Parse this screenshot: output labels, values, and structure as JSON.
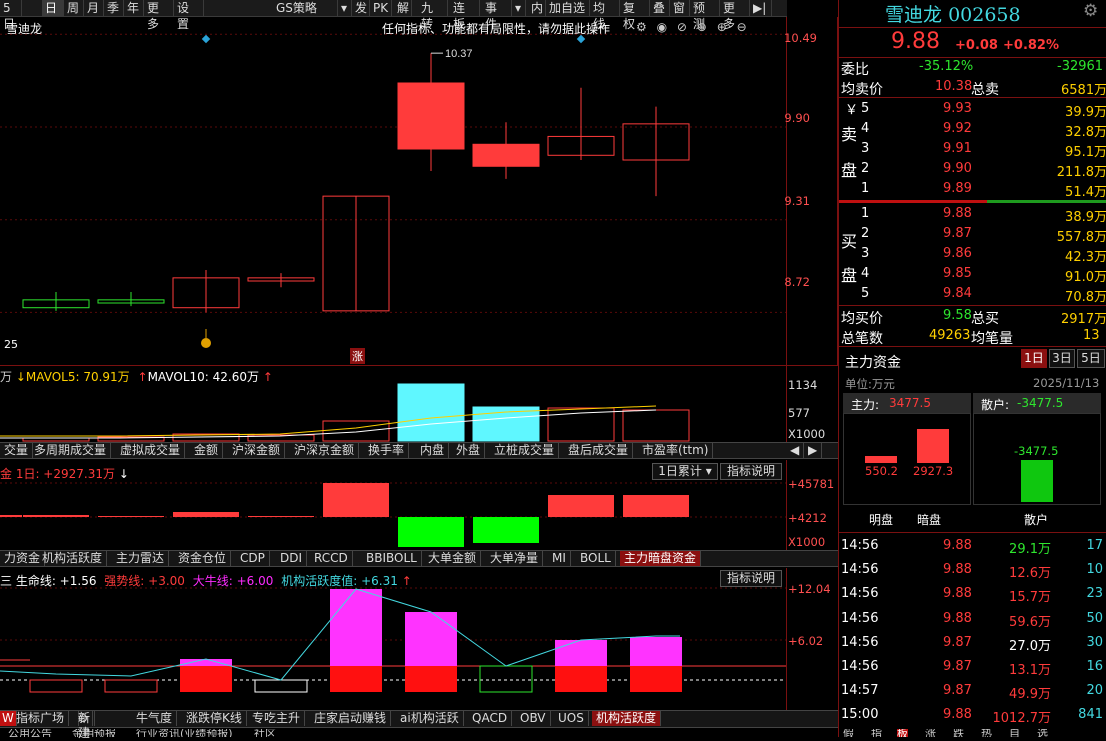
{
  "toolbar": {
    "items": [
      "5日",
      "日",
      "周",
      "月",
      "季",
      "年",
      "更多",
      "设置",
      "GS策略",
      "▾",
      "发",
      "PK",
      "解",
      "九转",
      "连板",
      "事件",
      "▾",
      "内",
      "加自选",
      "均线",
      "复权",
      "叠",
      "窗",
      "预测",
      "更多",
      "▶|"
    ]
  },
  "chart": {
    "title": "雪迪龙",
    "notice": "任何指标、功能都有局限性，请勿据此操作",
    "price_ticks": [
      "10.49",
      "9.90",
      "9.31",
      "8.72"
    ],
    "high_label": "10.37",
    "low_marker": "25",
    "zhang_marker": "涨",
    "candles": [
      {
        "o": 8.75,
        "c": 8.8,
        "h": 8.85,
        "l": 8.73,
        "color": "green"
      },
      {
        "o": 8.78,
        "c": 8.8,
        "h": 8.85,
        "l": 8.76,
        "color": "green"
      },
      {
        "o": 8.75,
        "c": 8.94,
        "h": 8.99,
        "l": 8.72,
        "color": "red"
      },
      {
        "o": 8.92,
        "c": 8.94,
        "h": 8.97,
        "l": 8.88,
        "color": "red"
      },
      {
        "o": 8.73,
        "c": 9.46,
        "h": 9.46,
        "l": 8.73,
        "color": "red_hollow"
      },
      {
        "o": 9.76,
        "c": 10.18,
        "h": 10.37,
        "l": 9.62,
        "color": "red_fill"
      },
      {
        "o": 9.65,
        "c": 9.79,
        "h": 9.93,
        "l": 9.57,
        "color": "red_fill"
      },
      {
        "o": 9.72,
        "c": 9.84,
        "h": 10.15,
        "l": 9.69,
        "color": "red_hollow"
      },
      {
        "o": 9.69,
        "c": 9.92,
        "h": 10.03,
        "l": 9.46,
        "color": "red_hollow"
      }
    ],
    "ylim": [
      8.5,
      10.6
    ]
  },
  "volume": {
    "legend_prefix": "万",
    "mavol5": "MAVOL5: 70.91万",
    "mavol10": "MAVOL10: 42.60万",
    "ticks": [
      "1134",
      "577",
      "X1000"
    ]
  },
  "tabs1": [
    "交量",
    "多周期成交量",
    "虚拟成交量",
    "金额",
    "沪深金额",
    "沪深京金额",
    "换手率",
    "内盘",
    "外盘",
    "立桩成交量",
    "盘后成交量",
    "市盈率(ttm)"
  ],
  "capital": {
    "legend": "金 1日: +2927.31万",
    "selector": "1日累计",
    "explain": "指标说明",
    "ticks": [
      "+45781",
      "+4212",
      "X1000"
    ],
    "values": [
      -300,
      -300,
      -100,
      1400,
      -100,
      45781,
      -18000,
      -15500,
      30000,
      28000
    ]
  },
  "tabs2": [
    "力资金",
    "机构活跃度",
    "主力雷达",
    "资金仓位",
    "CDP",
    "DDI",
    "RCCD",
    "BBIBOLL",
    "大单金额",
    "大单净量",
    "MI",
    "BOLL",
    "主力暗盘资金"
  ],
  "activity": {
    "legend_a": "生命线: +1.56",
    "legend_b": "强势线: +3.00",
    "legend_c": "大牛线: +6.00",
    "legend_d": "机构活跃度值: +6.31",
    "explain": "指标说明",
    "ticks": [
      "+12.04",
      "+6.02"
    ]
  },
  "bottom_tabs": [
    "W",
    "指标广场",
    "新建",
    "牛气度",
    "涨跌停K线",
    "专吃主升",
    "庄家启动赚钱",
    "ai机构活跃",
    "QACD",
    "OBV",
    "UOS",
    "机构活跃度"
  ],
  "bottom_tabs2": [
    "公用公告",
    "金明预报",
    "行业资讯(业绩预报)",
    "社区"
  ],
  "stock": {
    "name": "雪迪龙",
    "code": "002658",
    "price": "9.88",
    "change": "+0.08",
    "pct": "+0.82%"
  },
  "weibi": {
    "label": "委比",
    "pct": "-35.12%",
    "val": "-32961"
  },
  "avg_sell": {
    "label": "均卖价",
    "price": "10.38",
    "total_label": "总卖",
    "total": "6581万"
  },
  "sells": [
    {
      "n": "5",
      "p": "9.93",
      "v": "39.9万"
    },
    {
      "n": "4",
      "p": "9.92",
      "v": "32.8万"
    },
    {
      "n": "3",
      "p": "9.91",
      "v": "95.1万"
    },
    {
      "n": "2",
      "p": "9.90",
      "v": "211.8万"
    },
    {
      "n": "1",
      "p": "9.89",
      "v": "51.4万"
    }
  ],
  "buys": [
    {
      "n": "1",
      "p": "9.88",
      "v": "38.9万"
    },
    {
      "n": "2",
      "p": "9.87",
      "v": "557.8万"
    },
    {
      "n": "3",
      "p": "9.86",
      "v": "42.3万"
    },
    {
      "n": "4",
      "p": "9.85",
      "v": "91.0万"
    },
    {
      "n": "5",
      "p": "9.84",
      "v": "70.8万"
    }
  ],
  "sell_side": [
    "￥",
    "卖",
    "盘"
  ],
  "buy_side": [
    "买",
    "盘"
  ],
  "avg_buy": {
    "label": "均买价",
    "price": "9.58",
    "total_label": "总买",
    "total": "2917万"
  },
  "totals": {
    "count_label": "总笔数",
    "count": "49263",
    "avg_label": "均笔量",
    "avg": "13"
  },
  "main_fund": {
    "title": "主力资金",
    "periods": [
      "1日",
      "3日",
      "5日"
    ],
    "unit": "单位:万元",
    "date": "2025/11/13",
    "main_label": "主力:",
    "main_val": "3477.5",
    "retail_label": "散户:",
    "retail_val": "-3477.5",
    "bar_ming": "550.2",
    "bar_an": "2927.3",
    "retail_bar": "-3477.5",
    "x_labels": [
      "明盘",
      "暗盘",
      "散户"
    ]
  },
  "ticks": [
    {
      "t": "14:56",
      "p": "9.88",
      "v": "29.1万",
      "n": "17",
      "vc": "g"
    },
    {
      "t": "14:56",
      "p": "9.88",
      "v": "12.6万",
      "n": "10",
      "vc": "r"
    },
    {
      "t": "14:56",
      "p": "9.88",
      "v": "15.7万",
      "n": "23",
      "vc": "r"
    },
    {
      "t": "14:56",
      "p": "9.88",
      "v": "59.6万",
      "n": "50",
      "vc": "r"
    },
    {
      "t": "14:56",
      "p": "9.87",
      "v": "27.0万",
      "n": "30",
      "vc": "w"
    },
    {
      "t": "14:56",
      "p": "9.87",
      "v": "13.1万",
      "n": "16",
      "vc": "r"
    },
    {
      "t": "14:57",
      "p": "9.87",
      "v": "49.9万",
      "n": "20",
      "vc": "r"
    },
    {
      "t": "15:00",
      "p": "9.88",
      "v": "1012.7万",
      "n": "841",
      "vc": "r"
    }
  ],
  "bottom_right": [
    "假",
    "指",
    "板",
    "涨",
    "跌",
    "热",
    "自",
    "选"
  ]
}
